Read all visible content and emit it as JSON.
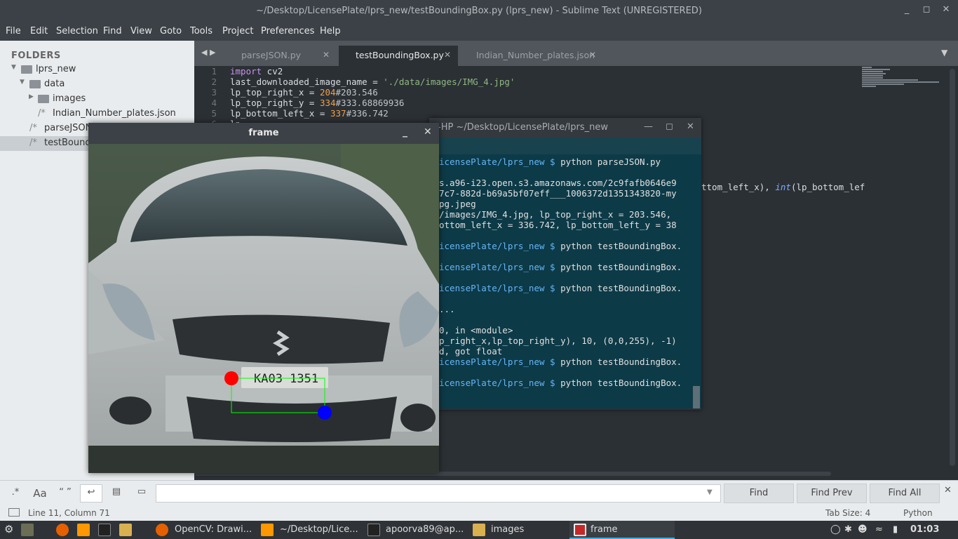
{
  "window": {
    "title": "~/Desktop/LicensePlate/lprs_new/testBoundingBox.py (lprs_new) - Sublime Text (UNREGISTERED)"
  },
  "menu": [
    "File",
    "Edit",
    "Selection",
    "Find",
    "View",
    "Goto",
    "Tools",
    "Project",
    "Preferences",
    "Help"
  ],
  "sidebar": {
    "header": "FOLDERS",
    "items": [
      {
        "label": "lprs_new",
        "type": "folder-open"
      },
      {
        "label": "data",
        "type": "folder-open"
      },
      {
        "label": "images",
        "type": "folder-closed"
      },
      {
        "label": "Indian_Number_plates.json",
        "type": "file"
      },
      {
        "label": "parseJSON",
        "type": "file"
      },
      {
        "label": "testBound",
        "type": "file"
      }
    ]
  },
  "tabs": [
    {
      "label": "parseJSON.py",
      "active": false
    },
    {
      "label": "testBoundingBox.py",
      "active": true
    },
    {
      "label": "Indian_Number_plates.json",
      "active": false
    }
  ],
  "editor": {
    "line_numbers": [
      "1",
      "2",
      "3",
      "4",
      "5",
      "6"
    ],
    "code": {
      "l1_kw": "import",
      "l1_rest": " cv2",
      "l2_a": "last_downloaded_image_name = ",
      "l2_str": "'./data/images/IMG_4.jpg'",
      "l3_a": "lp_top_right_x = ",
      "l3_num": "204",
      "l3_cmt": "#203.546",
      "l4_a": "lp_top_right_y = ",
      "l4_num": "334",
      "l4_cmt": "#333.68869936",
      "l5_a": "lp_bottom_left_x = ",
      "l5_num": "337",
      "l5_cmt": "#336.742",
      "l6_a": "lp"
    },
    "ghost_right": "ttom_left_x), ",
    "ghost_int": "int",
    "ghost_tail": "(lp_bottom_lef"
  },
  "terminal": {
    "title": "-HP ~/Desktop/LicensePlate/lprs_new",
    "lines": [
      {
        "prompt": "icensePlate/lprs_new $ ",
        "text": "python parseJSON.py"
      },
      {
        "prompt": "",
        "text": "s.a96-i23.open.s3.amazonaws.com/2c9fafb0646e9"
      },
      {
        "prompt": "",
        "text": "7c7-882d-b69a5bf07eff___1006372d1351343820-my"
      },
      {
        "prompt": "",
        "text": "pg.jpeg"
      },
      {
        "prompt": "",
        "text": "/images/IMG_4.jpg, lp_top_right_x = 203.546,"
      },
      {
        "prompt": "",
        "text": "ottom_left_x = 336.742, lp_bottom_left_y = 38"
      },
      {
        "prompt": "icensePlate/lprs_new $ ",
        "text": "python testBoundingBox."
      },
      {
        "prompt": "icensePlate/lprs_new $ ",
        "text": "python testBoundingBox."
      },
      {
        "prompt": "icensePlate/lprs_new $ ",
        "text": "python testBoundingBox."
      },
      {
        "prompt": "",
        "text": "..."
      },
      {
        "prompt": "",
        "text": "0, in <module>"
      },
      {
        "prompt": "",
        "text": "p_right_x,lp_top_right_y), 10, (0,0,255), -1)"
      },
      {
        "prompt": "",
        "text": "d, got float"
      },
      {
        "prompt": "icensePlate/lprs_new $ ",
        "text": "python testBoundingBox."
      },
      {
        "prompt": "icensePlate/lprs_new $ ",
        "text": "python testBoundingBox."
      }
    ]
  },
  "frame_window": {
    "title": "frame",
    "plate_text": "KA03 1351",
    "colors": {
      "top_point": "#ff0000",
      "bottom_point": "#0000ff",
      "box": "#00ff00"
    }
  },
  "findbar": {
    "regex": ".*",
    "case": "Aa",
    "word": "“ ”",
    "find": "Find",
    "find_prev": "Find Prev",
    "find_all": "Find All",
    "value": ""
  },
  "status": {
    "position": "Line 11, Column 71",
    "tab_size": "Tab Size: 4",
    "syntax": "Python"
  },
  "taskbar": {
    "items": [
      {
        "label": "OpenCV: Drawi...",
        "icon": "firefox-icon"
      },
      {
        "label": "~/Desktop/Lice...",
        "icon": "sublime-icon"
      },
      {
        "label": "apoorva89@ap...",
        "icon": "terminal-icon"
      },
      {
        "label": "images",
        "icon": "folder-icon"
      },
      {
        "label": "frame",
        "icon": "window-icon",
        "active": true
      }
    ],
    "clock": "01:03"
  }
}
